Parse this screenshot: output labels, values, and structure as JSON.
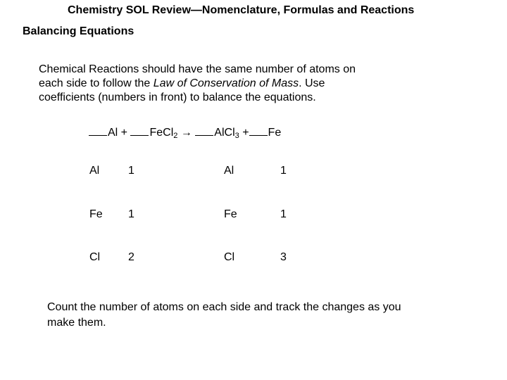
{
  "header": {
    "title": "Chemistry SOL Review—Nomenclature, Formulas and Reactions",
    "subtitle": "Balancing Equations"
  },
  "intro": {
    "line1": "Chemical Reactions should have the same number of atoms on",
    "line2_before": "each side to follow the ",
    "line2_italic": "Law of Conservation of Mass",
    "line2_after": ".  Use",
    "line3": "coefficients (numbers in front) to balance the equations."
  },
  "equation": {
    "term1": "Al +",
    "term2_base": "FeCl",
    "term2_sub": "2",
    "arrow": "→",
    "term3_base": "AlCl",
    "term3_sub": "3",
    "plus": "+",
    "term4": "Fe"
  },
  "atom_count": {
    "reactants": [
      {
        "element": "Al",
        "count": "1"
      },
      {
        "element": "Fe",
        "count": "1"
      },
      {
        "element": "Cl",
        "count": "2"
      }
    ],
    "products": [
      {
        "element": "Al",
        "count": "1"
      },
      {
        "element": "Fe",
        "count": "1"
      },
      {
        "element": "Cl",
        "count": "3"
      }
    ]
  },
  "footer": {
    "line1": "Count the number of atoms on each side and track the changes as you",
    "line2": "make them."
  }
}
